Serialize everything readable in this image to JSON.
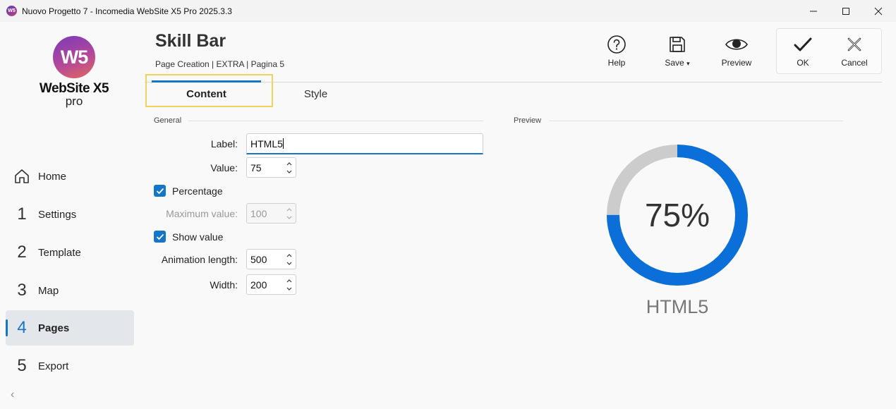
{
  "window": {
    "title": "Nuovo Progetto 7 - Incomedia WebSite X5 Pro 2025.3.3",
    "app_icon_text": "W5"
  },
  "sidebar": {
    "logo": {
      "mark": "W5",
      "name": "WebSite X5",
      "edition": "pro"
    },
    "items": [
      {
        "label": "Home",
        "icon": "home-icon"
      },
      {
        "num": "1",
        "label": "Settings"
      },
      {
        "num": "2",
        "label": "Template"
      },
      {
        "num": "3",
        "label": "Map"
      },
      {
        "num": "4",
        "label": "Pages",
        "active": true
      },
      {
        "num": "5",
        "label": "Export"
      }
    ],
    "collapse": "‹"
  },
  "header": {
    "title": "Skill Bar",
    "breadcrumb": "Page Creation | EXTRA | Pagina 5"
  },
  "toolbar": {
    "help": "Help",
    "save": "Save",
    "save_caret": "▾",
    "preview": "Preview",
    "ok": "OK",
    "cancel": "Cancel"
  },
  "tabs": [
    {
      "label": "Content",
      "active": true
    },
    {
      "label": "Style"
    }
  ],
  "general": {
    "section": "General",
    "label_label": "Label:",
    "label_value": "HTML5",
    "value_label": "Value:",
    "value_value": "75",
    "percentage_label": "Percentage",
    "percentage_checked": true,
    "max_label": "Maximum value:",
    "max_value": "100",
    "show_value_label": "Show value",
    "show_value_checked": true,
    "anim_label": "Animation length:",
    "anim_value": "500",
    "width_label": "Width:",
    "width_value": "200"
  },
  "preview": {
    "section": "Preview",
    "value_text": "75%",
    "caption": "HTML5",
    "fill_fraction": 0.75,
    "bar_color": "#0a6fd8",
    "track_color": "#cccccc"
  },
  "colors": {
    "accent": "#1575c7",
    "highlight": "#f1d25a"
  }
}
